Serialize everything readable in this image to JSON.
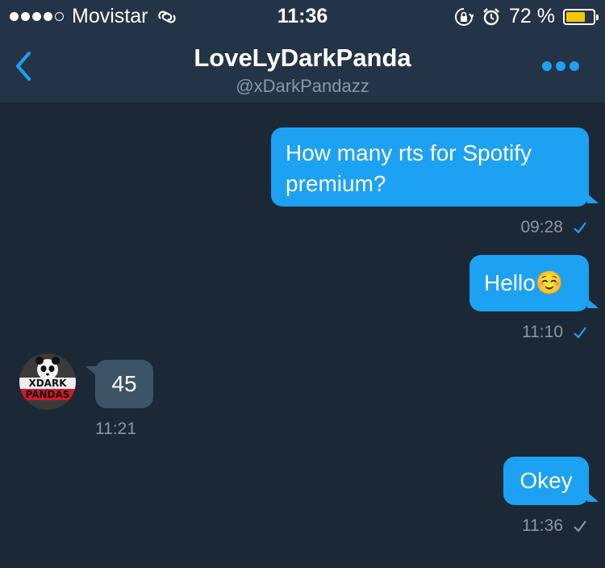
{
  "status_bar": {
    "carrier": "Movistar",
    "time": "11:36",
    "battery_percent": "72 %",
    "battery_level": 0.72,
    "signal_bars_filled": 4,
    "signal_bars_total": 5,
    "icons": [
      "signal-dots-icon",
      "link-icon",
      "rotation-lock-icon",
      "alarm-icon",
      "battery-icon"
    ]
  },
  "nav": {
    "title": "LoveLyDarkPanda",
    "subtitle": "@xDarkPandazz",
    "back_icon": "chevron-left-icon",
    "more_icon": "more-dots-icon"
  },
  "colors": {
    "background": "#1b2836",
    "bar": "#243447",
    "accent": "#1da1f2",
    "incoming_bubble": "#3d5466",
    "muted_text": "#8899a6",
    "battery": "#f5c600"
  },
  "messages": [
    {
      "direction": "outgoing",
      "text_line1": "How many rts for Spotify",
      "text_line2": "premium?",
      "time": "09:28",
      "status": "read"
    },
    {
      "direction": "outgoing",
      "text": "Hello☺️",
      "time": "11:10",
      "status": "read"
    },
    {
      "direction": "incoming",
      "text": "45",
      "time": "11:21",
      "avatar_text_top": "XDARK",
      "avatar_text_bottom": "PANDAS"
    },
    {
      "direction": "outgoing",
      "text": "Okey",
      "time": "11:36",
      "status": "sent"
    }
  ]
}
